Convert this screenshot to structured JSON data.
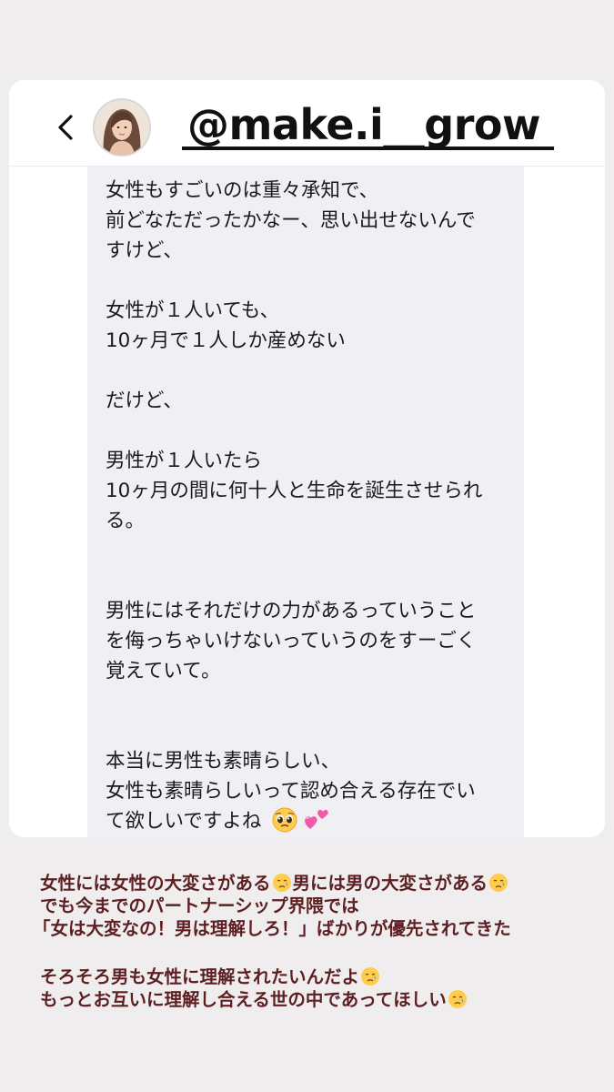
{
  "header": {
    "handle": "@make.i__grow",
    "back_icon": "chevron-left-icon",
    "avatar_icon": "profile-avatar"
  },
  "message": {
    "lines": [
      "女性もすごいのは重々承知で、",
      "前どなただったかなー、思い出せないんで",
      "すけど、",
      "女性が１人いても、",
      "10ヶ月で１人しか産めない",
      "だけど、",
      "男性が１人いたら",
      "10ヶ月の間に何十人と生命を誕生させられ",
      "る。",
      "男性にはそれだけの力があるっていうこと",
      "を侮っちゃいけないっていうのをすーごく",
      "覚えていて。",
      "本当に男性も素晴らしい、",
      "女性も素晴らしいって認め合える存在でい",
      "て欲しいですよね"
    ],
    "end_emojis": [
      "pleading-face-icon",
      "two-hearts-icon"
    ]
  },
  "caption": {
    "line1": "女性には女性の大変さがある",
    "line1b": "男には男の大変さがある",
    "line2": "でも今までのパートナーシップ界隈では",
    "line3": "「女は大変なの！男は理解しろ！」ばかりが優先されてきた",
    "line4": "そろそろ男も女性に理解されたいんだよ",
    "line5": "もっとお互いに理解し合える世の中であってほしい",
    "emoji_icon": "crying-face-icon"
  },
  "colors": {
    "caption_text": "#5e1f22",
    "bubble_bg": "#f0f0f4",
    "page_bg": "#efeded"
  }
}
